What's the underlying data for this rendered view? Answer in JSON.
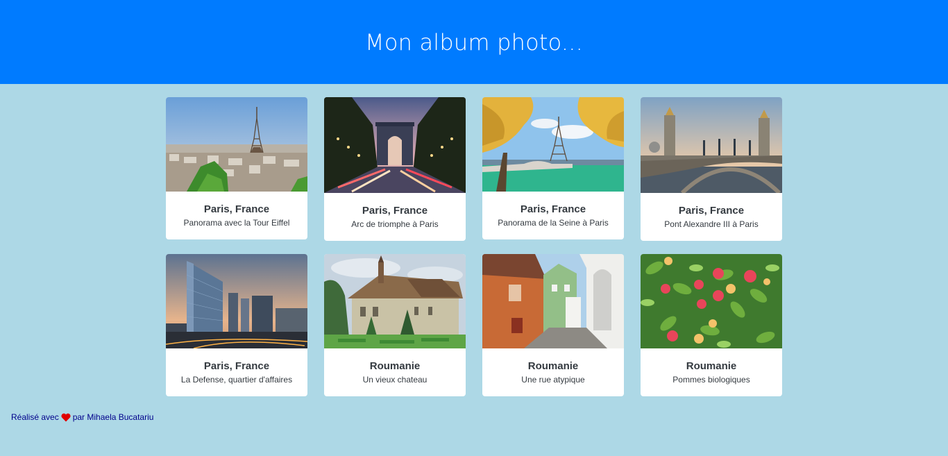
{
  "header": {
    "title": "Mon album photo..."
  },
  "cards": [
    {
      "title": "Paris, France",
      "text": "Panorama avec la Tour Eiffel"
    },
    {
      "title": "Paris, France",
      "text": "Arc de triomphe à Paris"
    },
    {
      "title": "Paris, France",
      "text": "Panorama de la Seine à Paris"
    },
    {
      "title": "Paris, France",
      "text": "Pont Alexandre III à Paris"
    },
    {
      "title": "Paris, France",
      "text": "La Defense, quartier d'affaires"
    },
    {
      "title": "Roumanie",
      "text": "Un vieux chateau"
    },
    {
      "title": "Roumanie",
      "text": "Une rue atypique"
    },
    {
      "title": "Roumanie",
      "text": "Pommes biologiques"
    }
  ],
  "footer": {
    "prefix": "Réalisé avec",
    "icon": "heart-icon",
    "suffix": "par Mihaela Bucatariu",
    "heart_color": "#e00000"
  },
  "colors": {
    "header_bg": "#007bff",
    "page_bg": "#add8e6",
    "footer_text": "#00008b"
  }
}
